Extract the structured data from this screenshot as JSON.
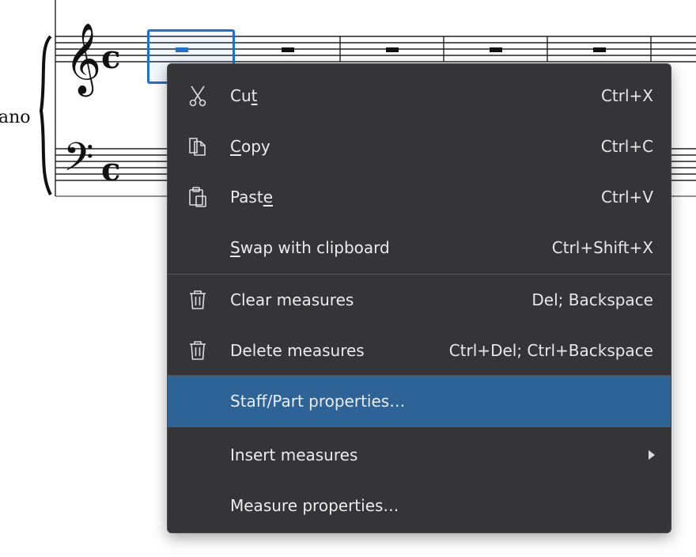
{
  "score": {
    "instrument_label": "ano"
  },
  "context_menu": {
    "items": [
      {
        "pre": "Cu",
        "mn": "t",
        "post": "",
        "shortcut": "Ctrl+X",
        "icon": "scissors-icon"
      },
      {
        "pre": "",
        "mn": "C",
        "post": "opy",
        "shortcut": "Ctrl+C",
        "icon": "copy-icon"
      },
      {
        "pre": "Past",
        "mn": "e",
        "post": "",
        "shortcut": "Ctrl+V",
        "icon": "paste-icon"
      },
      {
        "pre": "",
        "mn": "S",
        "post": "wap with clipboard",
        "shortcut": "Ctrl+Shift+X",
        "icon": ""
      },
      {
        "label": "Clear measures",
        "shortcut": "Del; Backspace",
        "icon": "trash-icon"
      },
      {
        "label": "Delete measures",
        "shortcut": "Ctrl+Del; Ctrl+Backspace",
        "icon": "trash-icon"
      },
      {
        "label": "Staff/Part properties…",
        "shortcut": "",
        "icon": "",
        "highlighted": true
      },
      {
        "label": "Insert measures",
        "shortcut": "",
        "icon": "",
        "submenu": true
      },
      {
        "label": "Measure properties…",
        "shortcut": "",
        "icon": ""
      }
    ]
  },
  "colors": {
    "menu_bg": "#353538",
    "highlight": "#2e6398",
    "selection": "#1f6fd6"
  }
}
